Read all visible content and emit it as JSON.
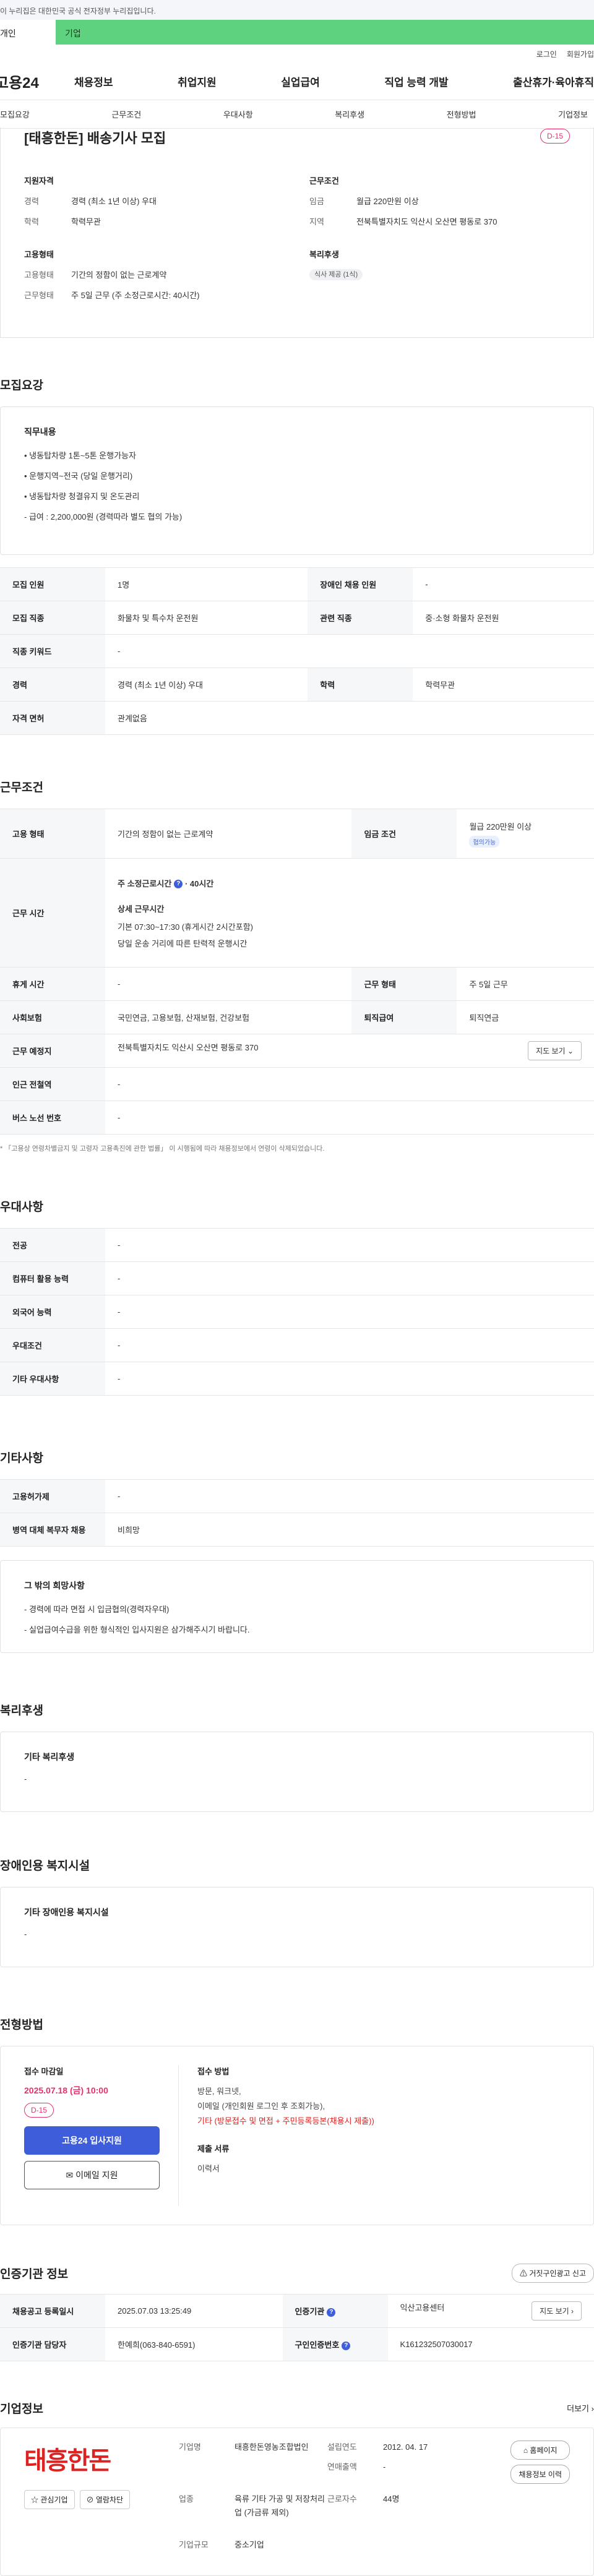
{
  "banner": {
    "text": "이 누리집은 대한민국 공식 전자정부 누리집입니다."
  },
  "tabs": {
    "person": "개인",
    "company": "기업"
  },
  "util": {
    "login": "로그인",
    "join": "회원가입"
  },
  "gnb": {
    "logo": "고용24",
    "menu": [
      "채용정보",
      "취업지원",
      "실업급여",
      "직업 능력 개발",
      "출산휴가·육아휴직"
    ]
  },
  "subnav": [
    "모집요강",
    "근무조건",
    "우대사항",
    "복리후생",
    "전형방법",
    "기업정보"
  ],
  "summary": {
    "title": "[태흥한돈] 배송기사 모집",
    "dday": "D-15",
    "qual_h": "지원자격",
    "career_k": "경력",
    "career_v": "경력 (최소 1년 이상) 우대",
    "edu_k": "학력",
    "edu_v": "학력무관",
    "cond_h": "근무조건",
    "wage_k": "임금",
    "wage_v": "월급 220만원 이상",
    "region_k": "지역",
    "region_v": "전북특별자치도 익산시 오산면 평동로 370",
    "emp_h": "고용형태",
    "emptype_k": "고용형태",
    "emptype_v": "기간의 정함이 없는 근로계약",
    "worktype_k": "근무형태",
    "worktype_v": "주 5일 근무 (주 소정근로시간: 40시간)",
    "welfare_h": "복리후생",
    "welfare_badge": "식사 제공 (1식)"
  },
  "recruit": {
    "heading": "모집요강",
    "duty_h": "직무내용",
    "duties": [
      "• 냉동탑차량 1톤~5톤 운행가능자",
      "• 운행지역~전국 (당일 운행거리)",
      "• 냉동탑차량 청결유지 및 온도관리",
      "- 급여 : 2,200,000원 (경력따라 별도 협의 가능)"
    ],
    "table": [
      [
        "모집 인원",
        "1명",
        "장애인 채용 인원",
        "-"
      ],
      [
        "모집 직종",
        "화물차 및 특수차 운전원",
        "관련 직종",
        "중·소형 화물차 운전원"
      ],
      [
        "직종 키워드",
        "-",
        "",
        ""
      ],
      [
        "경력",
        "경력 (최소 1년 이상) 우대",
        "학력",
        "학력무관"
      ],
      [
        "자격 면허",
        "관계없음",
        "",
        ""
      ]
    ]
  },
  "conditions": {
    "heading": "근무조건",
    "emp_k": "고용 형태",
    "emp_v": "기간의 정함이 없는 근로계약",
    "wage_k": "임금 조건",
    "wage_v": "월급 220만원 이상",
    "wage_badge": "협의가능",
    "time_k": "근무 시간",
    "time_main": "주 소정근로시간",
    "time_hours": "· 40시간",
    "detail_h": "상세 근무시간",
    "detail_1": "기본 07:30~17:30 (휴게시간 2시간포함)",
    "detail_2": "당일 운송 거리에 따른 탄력적 운행시간",
    "rest_k": "휴게 시간",
    "rest_v": "-",
    "form_k": "근무 형태",
    "form_v": "주 5일 근무",
    "ins_k": "사회보험",
    "ins_v": "국민연금, 고용보험, 산재보험, 건강보험",
    "ret_k": "퇴직급여",
    "ret_v": "퇴직연금",
    "addr_k": "근무 예정지",
    "addr_v": "전북특별자치도 익산시 오산면 평동로 370",
    "map_btn": "지도 보기",
    "subway_k": "인근 전철역",
    "subway_v": "-",
    "bus_k": "버스 노선 번호",
    "bus_v": "-",
    "note": "* 「고용상 연령차별금지 및 고령자 고용촉진에 관한 법률」 이 시행됨에 따라 채용정보에서 연령이 삭제되었습니다."
  },
  "preference": {
    "heading": "우대사항",
    "rows": [
      [
        "전공",
        "-"
      ],
      [
        "컴퓨터 활용 능력",
        "-"
      ],
      [
        "외국어 능력",
        "-"
      ],
      [
        "우대조건",
        "-"
      ],
      [
        "기타 우대사항",
        "-"
      ]
    ]
  },
  "others": {
    "heading": "기타사항",
    "rows": [
      [
        "고용허가제",
        "-"
      ],
      [
        "병역 대체 복무자 채용",
        "비희망"
      ]
    ],
    "etc_h": "그 밖의 희망사항",
    "etc_1": "- 경력에 따라 면접 시 입금협의(경력자우대)",
    "etc_2": "- 실업급여수급을 위한 형식적인 입사지원은 삼가해주시기 바랍니다."
  },
  "welfare": {
    "heading": "복리후생",
    "h": "기타 복리후생",
    "v": "-"
  },
  "disabled": {
    "heading": "장애인용 복지시설",
    "h": "기타 장애인용 복지시설",
    "v": "-"
  },
  "selection": {
    "heading": "전형방법",
    "deadline_h": "접수 마감일",
    "deadline": "2025.07.18 (금) 10:00",
    "dday": "D-15",
    "apply_btn": "고용24 입사지원",
    "email_btn": "이메일 지원",
    "method_h": "접수 방법",
    "method_1": "방문, 워크넷,",
    "method_2": "이메일 (개인회원 로그인 후 조회가능),",
    "method_3": "기타 (방문접수 및 면접 + 주민등록등본(채용시 제출))",
    "docs_h": "제출 서류",
    "docs_v": "이력서"
  },
  "cert": {
    "heading": "인증기관 정보",
    "report_btn": "거짓구인광고 신고",
    "reg_k": "채용공고 등록일시",
    "reg_v": "2025.07.03 13:25:49",
    "org_k": "인증기관",
    "org_v": "익산고용센터",
    "map_btn": "지도 보기",
    "mgr_k": "인증기관 담당자",
    "mgr_v": "한예희(063-840-6591)",
    "no_k": "구인인증번호",
    "no_v": "K161232507030017"
  },
  "company": {
    "heading": "기업정보",
    "more": "더보기",
    "logo_text": "태흥한돈",
    "fav_btn": "관심기업",
    "block_btn": "열람차단",
    "name_k": "기업명",
    "name_v": "태흥한돈영농조합법인",
    "found_k": "설립연도",
    "found_v": "2012. 04. 17",
    "sales_k": "연매출액",
    "sales_v": "-",
    "biz_k": "업종",
    "biz_v": "육류 기타 가공 및 저장처리업 (가금류 제외)",
    "staff_k": "근로자수",
    "staff_v": "44명",
    "scale_k": "기업규모",
    "scale_v": "중소기업",
    "homepage_btn": "홈페이지",
    "history_btn": "채용정보 이력"
  }
}
